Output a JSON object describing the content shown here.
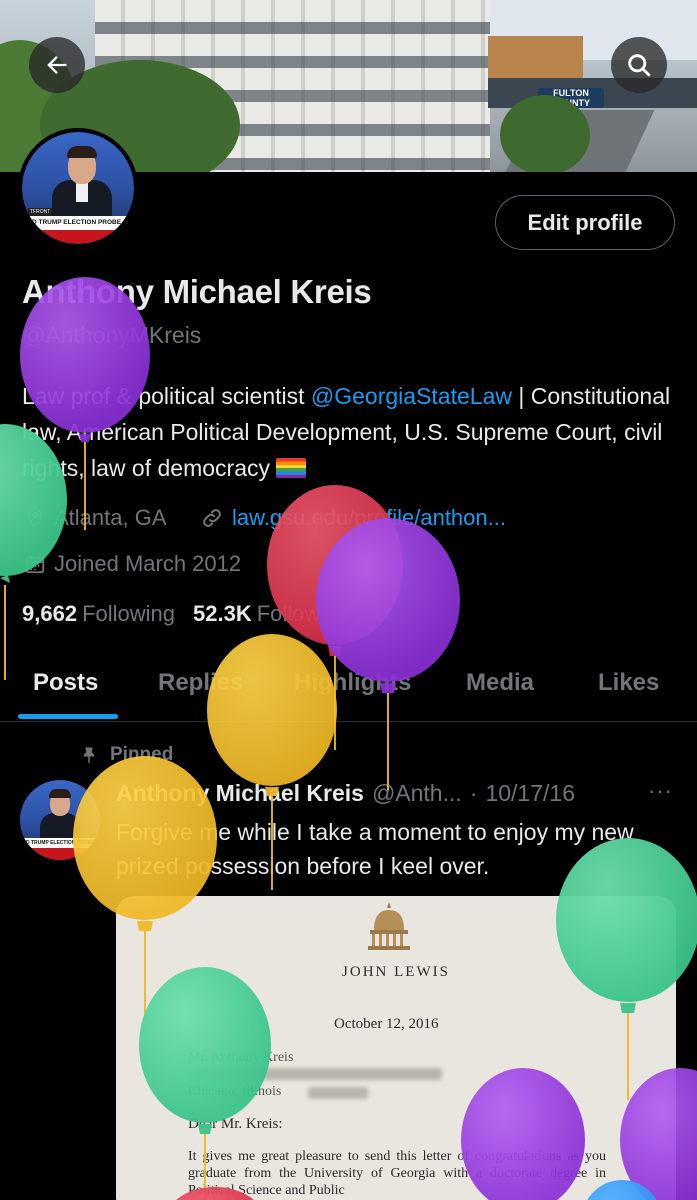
{
  "header": {
    "banner_sign": "FULTON COUNTY",
    "back_icon": "arrow-left-icon",
    "search_icon": "search-icon"
  },
  "profile": {
    "edit_label": "Edit profile",
    "name": "Anthony Michael Kreis",
    "handle": "@AnthonyMKreis",
    "bio_part1": "Law prof & political scientist ",
    "bio_link": "@GeorgiaStateLaw",
    "bio_part2": " | Constitutional law, American Political Development, U.S. Supreme Court, civil rights, law of democracy",
    "location": "Atlanta, GA",
    "website": "law.gsu.edu/profile/anthon...",
    "joined": "Joined March 2012",
    "following_count": "9,662",
    "following_label": "Following",
    "followers_count": "52.3K",
    "followers_label": "Followers",
    "avatar_chyron": "D TRUMP ELECTION PROBE",
    "avatar_sub": "Georgia State University",
    "avatar_front": "TFRONT"
  },
  "tabs": [
    {
      "label": "Posts",
      "active": true
    },
    {
      "label": "Replies",
      "active": false
    },
    {
      "label": "Highlights",
      "active": false
    },
    {
      "label": "Media",
      "active": false
    },
    {
      "label": "Likes",
      "active": false
    }
  ],
  "post": {
    "pinned_label": "Pinned",
    "author": "Anthony Michael Kreis",
    "handle": "@Anth...",
    "separator": "·",
    "date": "10/17/16",
    "more": "···",
    "text": "Forgive me while I take a moment to enjoy my new prized possession before I keel over.",
    "avatar_chyron": "D TRUMP ELECTION PROBE"
  },
  "letter": {
    "letterhead": "JOHN LEWIS",
    "date": "October 12, 2016",
    "addr_line1": "Mr. Anthony Kreis",
    "addr_line2": "Chicago, Illinois",
    "salutation": "Dear Mr. Kreis:",
    "body": "It gives me great pleasure to send this letter of congratulations as you graduate from the University of Georgia with a doctorate degree in Political Science and Public"
  },
  "colors": {
    "accent": "#1d9bf0",
    "muted": "#71767b",
    "text": "#e7e9ea",
    "background": "#000000"
  }
}
